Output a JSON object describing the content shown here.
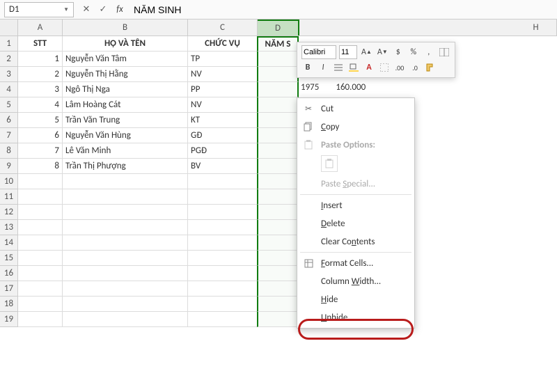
{
  "name_box": "D1",
  "formula_value": "NĂM SINH",
  "columns": [
    "A",
    "B",
    "C",
    "D",
    "H"
  ],
  "headers": {
    "A": "STT",
    "B": "HỌ VÀ TÊN",
    "C": "CHỨC VỤ",
    "D": "NĂM S"
  },
  "rows": [
    {
      "stt": "1",
      "name": "Nguyễn Văn Tâm",
      "role": "TP"
    },
    {
      "stt": "2",
      "name": "Nguyễn Thị Hằng",
      "role": "NV"
    },
    {
      "stt": "3",
      "name": "Ngô Thị Nga",
      "role": "PP"
    },
    {
      "stt": "4",
      "name": "Lâm Hoàng Cát",
      "role": "NV"
    },
    {
      "stt": "5",
      "name": "Trần Văn Trung",
      "role": "KT"
    },
    {
      "stt": "6",
      "name": "Nguyễn Văn Hùng",
      "role": "GĐ"
    },
    {
      "stt": "7",
      "name": "Lê Văn Minh",
      "role": "PGĐ"
    },
    {
      "stt": "8",
      "name": "Trần Thị Phượng",
      "role": "BV"
    }
  ],
  "veil": {
    "year": "1975",
    "salary": "160.000"
  },
  "mini": {
    "font": "Calibri",
    "size": "11",
    "buttons": {
      "bold": "B",
      "italic": "I",
      "fontup": "A",
      "fontdown": "A",
      "currency": "$",
      "percent": "%",
      "comma": ","
    }
  },
  "menu": {
    "cut": "Cut",
    "copy": "Copy",
    "paste_options": "Paste Options:",
    "paste_special": "Paste Special...",
    "insert": "Insert",
    "delete": "Delete",
    "clear": "Clear Contents",
    "format_cells": "Format Cells...",
    "col_width": "Column Width...",
    "hide": "Hide",
    "unhide": "Unhide"
  }
}
